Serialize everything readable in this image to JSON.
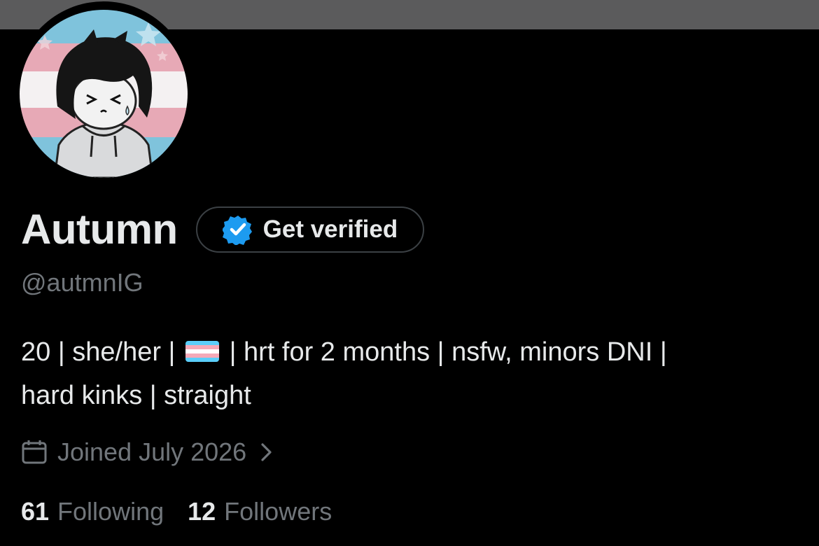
{
  "profile": {
    "display_name": "Autumn",
    "verify_label": "Get verified",
    "handle": "@autmnIG",
    "bio_line1_a": "20 | she/her |",
    "bio_line1_b": "| hrt for 2 months | nsfw, minors DNI |",
    "bio_line2": "hard kinks | straight",
    "bio_flag_icon": "transgender-flag",
    "joined_label": "Joined July 2026",
    "following_count": "61",
    "following_label": "Following",
    "followers_count": "12",
    "followers_label": "Followers"
  },
  "icons": {
    "verified_badge": "verified-badge-icon",
    "calendar": "calendar-icon",
    "chevron": "chevron-right-icon"
  },
  "colors": {
    "background": "#000000",
    "banner": "#5b5b5c",
    "text_primary": "#e7e9ea",
    "text_secondary": "#71767b",
    "verified_blue": "#1d9bf0",
    "trans_blue": "#5bcefa",
    "trans_pink": "#f5a9b8",
    "trans_white": "#ffffff"
  }
}
